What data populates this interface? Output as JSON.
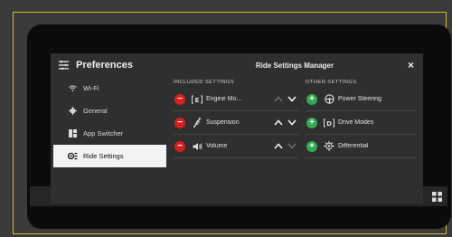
{
  "sidebar": {
    "title": "Preferences",
    "items": [
      {
        "label": "Wi-Fi",
        "icon": "wifi-icon"
      },
      {
        "label": "General",
        "icon": "gear-icon"
      },
      {
        "label": "App Switcher",
        "icon": "app-switcher-icon"
      },
      {
        "label": "Ride Settings",
        "icon": "ride-settings-icon",
        "active": true
      }
    ]
  },
  "dialog": {
    "title": "Ride Settings Manager",
    "close_label": "×"
  },
  "included": {
    "heading": "INCLUDED SETTINGS",
    "items": [
      {
        "label": "Engine Mo...",
        "icon": "engine-mode-icon",
        "up_enabled": false,
        "down_enabled": true
      },
      {
        "label": "Suspension",
        "icon": "suspension-icon",
        "up_enabled": true,
        "down_enabled": true
      },
      {
        "label": "Volume",
        "icon": "volume-icon",
        "up_enabled": true,
        "down_enabled": false
      }
    ]
  },
  "other": {
    "heading": "OTHER SETTINGS",
    "items": [
      {
        "label": "Power Steering",
        "icon": "steering-wheel-icon"
      },
      {
        "label": "Drive Modes",
        "icon": "drive-modes-icon"
      },
      {
        "label": "Differential",
        "icon": "differential-icon"
      }
    ]
  },
  "colors": {
    "frame_border": "#d6b52a",
    "remove": "#d42020",
    "add": "#34a853",
    "panel": "#2f2f2f"
  }
}
